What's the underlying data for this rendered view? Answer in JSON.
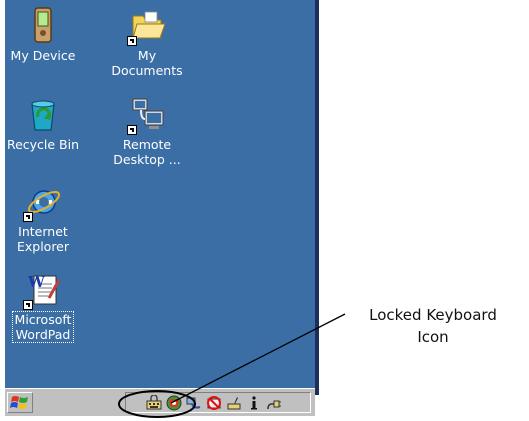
{
  "desktop": {
    "background_color": "#3a6ea5",
    "icons": [
      {
        "label": "My Device",
        "icon": "pda-device-icon"
      },
      {
        "label": "My\nDocuments",
        "icon": "folder-icon"
      },
      {
        "label": "Recycle Bin",
        "icon": "recycle-bin-icon"
      },
      {
        "label": "Remote\nDesktop ...",
        "icon": "remote-desktop-icon"
      },
      {
        "label": "Internet\nExplorer",
        "icon": "internet-explorer-icon"
      },
      {
        "label": "Microsoft\nWordPad",
        "icon": "wordpad-icon"
      }
    ]
  },
  "taskbar": {
    "start_icon": "windows-flag-icon",
    "tray_icons": [
      "locked-keyboard-icon",
      "network-globe-icon",
      "connection-icon",
      "battery-warning-icon",
      "pen-icon",
      "info-icon",
      "power-plug-icon"
    ]
  },
  "annotation": {
    "text": "Locked Keyboard\nIcon"
  }
}
